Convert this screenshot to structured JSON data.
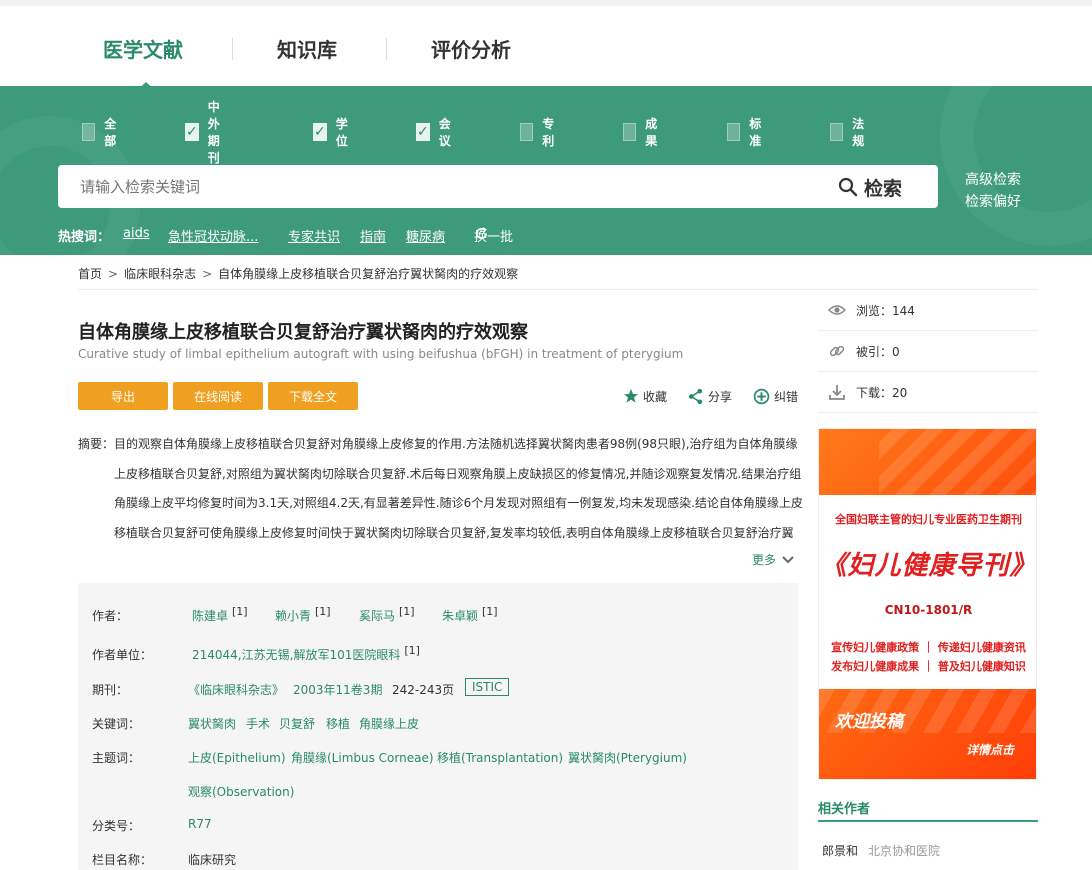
{
  "nav": {
    "tabs": [
      {
        "label": "医学文献",
        "active": true
      },
      {
        "label": "知识库",
        "active": false
      },
      {
        "label": "评价分析",
        "active": false
      }
    ]
  },
  "search": {
    "types": [
      {
        "label": "全部",
        "checked": false
      },
      {
        "label": "中外期刊",
        "checked": true
      },
      {
        "label": "学位",
        "checked": true
      },
      {
        "label": "会议",
        "checked": true
      },
      {
        "label": "专利",
        "checked": false
      },
      {
        "label": "成果",
        "checked": false
      },
      {
        "label": "标准",
        "checked": false
      },
      {
        "label": "法规",
        "checked": false
      }
    ],
    "placeholder": "请输入检索关键词",
    "button_label": "检索",
    "advanced_label": "高级检索",
    "preference_label": "检索偏好",
    "hot_label": "热搜词：",
    "hot_words": [
      "aids",
      "急性冠状动脉...",
      "专家共识",
      "指南",
      "糖尿病"
    ],
    "refresh_label": "换一批"
  },
  "breadcrumb": [
    "首页",
    "临床眼科杂志",
    "自体角膜缘上皮移植联合贝复舒治疗翼状胬肉的疗效观察"
  ],
  "article": {
    "title": "自体角膜缘上皮移植联合贝复舒治疗翼状胬肉的疗效观察",
    "subtitle": "Curative study of limbal epithelium autograft with using beifushua (bFGH) in treatment of pterygium",
    "buttons": {
      "export": "导出",
      "read_online": "在线阅读",
      "download": "下载全文"
    },
    "actions": {
      "favorite": "收藏",
      "share": "分享",
      "correct": "纠错"
    },
    "abstract_label": "摘要：",
    "abstract_lines": [
      "目的观察自体角膜缘上皮移植联合贝复舒对角膜缘上皮修复的作用.方法随机选择翼状胬肉患者98例(98只眼),治疗组为自体角膜缘",
      "上皮移植联合贝复舒,对照组为翼状胬肉切除联合贝复舒.术后每日观察角膜上皮缺损区的修复情况,并随诊观察复发情况.结果治疗组",
      "角膜缘上皮平均修复时间为3.1天,对照组4.2天,有显著差异性.随诊6个月发现对照组有一例复发,均未发现感染.结论自体角膜缘上皮",
      "移植联合贝复舒可使角膜缘上皮修复时间快于翼状胬肉切除联合贝复舒,复发率均较低,表明自体角膜缘上皮移植联合贝复舒治疗翼"
    ],
    "more_label": "更多"
  },
  "meta": {
    "authors_label": "作者：",
    "authors": [
      {
        "name": "陈建卓",
        "sup": "[1]"
      },
      {
        "name": "赖小青",
        "sup": "[1]"
      },
      {
        "name": "奚际马",
        "sup": "[1]"
      },
      {
        "name": "朱卓颖",
        "sup": "[1]"
      }
    ],
    "affiliation_label": "作者单位：",
    "affiliation": "214044,江苏无锡,解放军101医院眼科",
    "affiliation_sup": "[1]",
    "journal_label": "期刊：",
    "journal_name": "《临床眼科杂志》",
    "journal_issue": "2003年11卷3期",
    "journal_pages": "242-243页",
    "journal_badge": "ISTIC",
    "keywords_label": "关键词：",
    "keywords": [
      "翼状胬肉",
      "手术",
      "贝复舒",
      "移植",
      "角膜缘上皮"
    ],
    "subjects_label": "主题词：",
    "subjects": [
      "上皮(Epithelium)",
      "角膜缘(Limbus Corneae)",
      "移植(Transplantation)",
      "翼状胬肉(Pterygium)",
      "观察(Observation)"
    ],
    "class_label": "分类号：",
    "class_value": "R77",
    "column_label": "栏目名称：",
    "column_value": "临床研究"
  },
  "stats": {
    "views": "浏览：144",
    "cited": "被引：0",
    "downloads": "下载：20"
  },
  "ad": {
    "headline": "全国妇联主管的妇儿专业医药卫生期刊",
    "journal": "《妇儿健康导刊》",
    "cn": "CN10-1801/R",
    "slogan1": "宣传妇儿健康政策 ｜ 传递妇儿健康资讯",
    "slogan2": "发布妇儿健康成果 ｜ 普及妇儿健康知识",
    "welcome": "欢迎投稿",
    "detail": "详情点击"
  },
  "related": {
    "title": "相关作者",
    "items": [
      {
        "name": "郎景和",
        "org": "北京协和医院"
      }
    ]
  },
  "colors": {
    "green": "#3d9a7a",
    "accent_text": "#2a8a6a",
    "orange": "#f0a021"
  }
}
